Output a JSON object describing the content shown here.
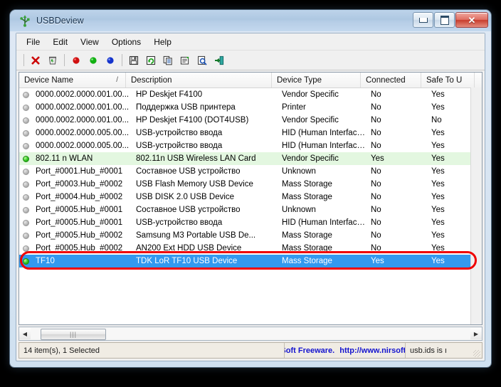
{
  "window": {
    "title": "USBDeview",
    "icon": "usb-icon",
    "caption_buttons": [
      {
        "name": "minimize-button",
        "label": "–"
      },
      {
        "name": "maximize-button",
        "label": "□"
      },
      {
        "name": "close-button",
        "label": "✕"
      }
    ]
  },
  "menubar": {
    "items": [
      "File",
      "Edit",
      "View",
      "Options",
      "Help"
    ]
  },
  "toolbar": {
    "buttons": [
      {
        "name": "uninstall-device-button",
        "icon": "red-x-icon"
      },
      {
        "name": "disable-device-button",
        "icon": "shield-recycle-icon"
      },
      {
        "name": "stop-device-button",
        "icon": "red-circle-icon"
      },
      {
        "name": "enable-device-button",
        "icon": "green-circle-icon"
      },
      {
        "name": "connect-device-button",
        "icon": "blue-circle-icon"
      },
      {
        "name": "save-button",
        "icon": "floppy-disk-icon"
      },
      {
        "name": "refresh-button",
        "icon": "refresh-icon"
      },
      {
        "name": "copy-button",
        "icon": "copy-icon"
      },
      {
        "name": "properties-button",
        "icon": "properties-icon"
      },
      {
        "name": "find-button",
        "icon": "find-icon"
      },
      {
        "name": "exit-button",
        "icon": "exit-door-icon"
      }
    ]
  },
  "list": {
    "columns": [
      {
        "label": "Device Name",
        "sort": "/"
      },
      {
        "label": "Description",
        "sort": ""
      },
      {
        "label": "Device Type",
        "sort": ""
      },
      {
        "label": "Connected",
        "sort": ""
      },
      {
        "label": "Safe To U",
        "sort": ""
      }
    ],
    "rows": [
      {
        "name": "0000.0002.0000.001.00...",
        "description": "HP Deskjet F4100",
        "type": "Vendor Specific",
        "connected": "No",
        "safe": "Yes",
        "state": "off"
      },
      {
        "name": "0000.0002.0000.001.00...",
        "description": "Поддержка USB принтера",
        "type": "Printer",
        "connected": "No",
        "safe": "Yes",
        "state": "off"
      },
      {
        "name": "0000.0002.0000.001.00...",
        "description": "HP Deskjet F4100 (DOT4USB)",
        "type": "Vendor Specific",
        "connected": "No",
        "safe": "No",
        "state": "off"
      },
      {
        "name": "0000.0002.0000.005.00...",
        "description": "USB-устройство ввода",
        "type": "HID (Human Interface D...",
        "connected": "No",
        "safe": "Yes",
        "state": "off"
      },
      {
        "name": "0000.0002.0000.005.00...",
        "description": "USB-устройство ввода",
        "type": "HID (Human Interface D...",
        "connected": "No",
        "safe": "Yes",
        "state": "off"
      },
      {
        "name": "802.11 n WLAN",
        "description": "802.11n USB Wireless LAN Card",
        "type": "Vendor Specific",
        "connected": "Yes",
        "safe": "Yes",
        "state": "on"
      },
      {
        "name": "Port_#0001.Hub_#0001",
        "description": "Составное USB устройство",
        "type": "Unknown",
        "connected": "No",
        "safe": "Yes",
        "state": "off"
      },
      {
        "name": "Port_#0003.Hub_#0002",
        "description": "USB Flash Memory USB Device",
        "type": "Mass Storage",
        "connected": "No",
        "safe": "Yes",
        "state": "off"
      },
      {
        "name": "Port_#0004.Hub_#0002",
        "description": "USB DISK 2.0 USB Device",
        "type": "Mass Storage",
        "connected": "No",
        "safe": "Yes",
        "state": "off"
      },
      {
        "name": "Port_#0005.Hub_#0001",
        "description": "Составное USB устройство",
        "type": "Unknown",
        "connected": "No",
        "safe": "Yes",
        "state": "off"
      },
      {
        "name": "Port_#0005.Hub_#0001",
        "description": "USB-устройство ввода",
        "type": "HID (Human Interface D...",
        "connected": "No",
        "safe": "Yes",
        "state": "off"
      },
      {
        "name": "Port_#0005.Hub_#0002",
        "description": "Samsung M3 Portable USB De...",
        "type": "Mass Storage",
        "connected": "No",
        "safe": "Yes",
        "state": "off"
      },
      {
        "name": "Port_#0005.Hub_#0002",
        "description": "AN200 Ext HDD USB Device",
        "type": "Mass Storage",
        "connected": "No",
        "safe": "Yes",
        "state": "off"
      },
      {
        "name": "TF10",
        "description": "TDK LoR TF10 USB Device",
        "type": "Mass Storage",
        "connected": "Yes",
        "safe": "Yes",
        "state": "on",
        "selected": true
      }
    ]
  },
  "statusbar": {
    "items_text": "14 item(s), 1 Selected",
    "credit_name": "NirSoft Freeware.",
    "credit_url": "http://www.nirsoft.net",
    "usb_ids": "usb.ids is ı"
  },
  "colors": {
    "selection": "#3399ef",
    "connected_row": "#e3f7e0",
    "annotation": "#ef0000",
    "link": "#1414cf"
  }
}
